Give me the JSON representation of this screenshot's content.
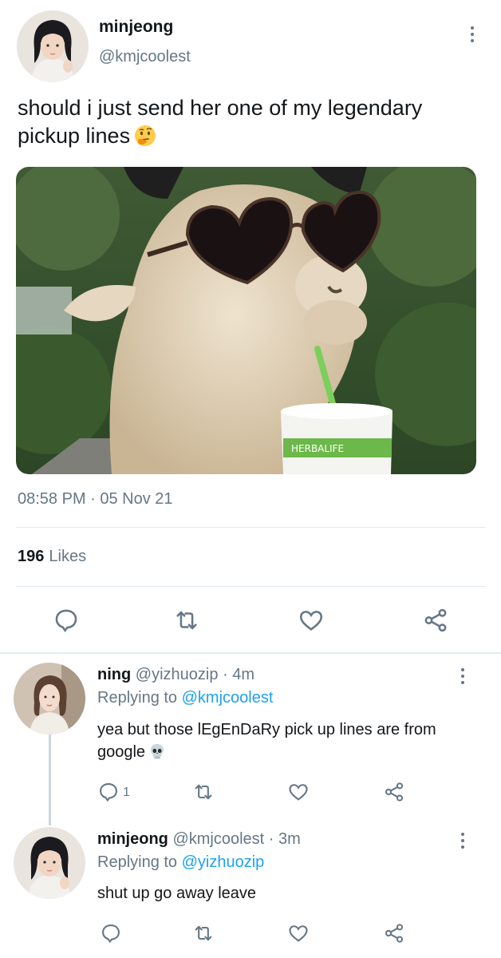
{
  "tweet": {
    "author_name": "minjeong",
    "author_handle": "@kmjcoolest",
    "text": "should i just send her one of my legendary pickup lines",
    "image": {
      "cup_label": "HERBALIFE"
    },
    "timestamp": "08:58 PM · 05 Nov 21",
    "likes_count": "196",
    "likes_label": "Likes",
    "actions": [
      "reply-icon",
      "retweet-icon",
      "like-icon",
      "share-icon"
    ]
  },
  "replies": [
    {
      "author_name": "ning",
      "author_handle": "@yizhuozip",
      "time": "· 4m",
      "replying_prefix": "Replying to",
      "replying_to": "@kmjcoolest",
      "text": "yea but those lEgEnDaRy pick up lines are from google",
      "reply_count": "1"
    },
    {
      "author_name": "minjeong",
      "author_handle": "@kmjcoolest",
      "time": "· 3m",
      "replying_prefix": "Replying to",
      "replying_to": "@yizhuozip",
      "text": "shut up go away leave",
      "reply_count": ""
    }
  ],
  "colors": {
    "accent": "#1da1f2",
    "secondary_text": "#657786",
    "primary_text": "#14171a",
    "divider": "#e1e8ed"
  }
}
